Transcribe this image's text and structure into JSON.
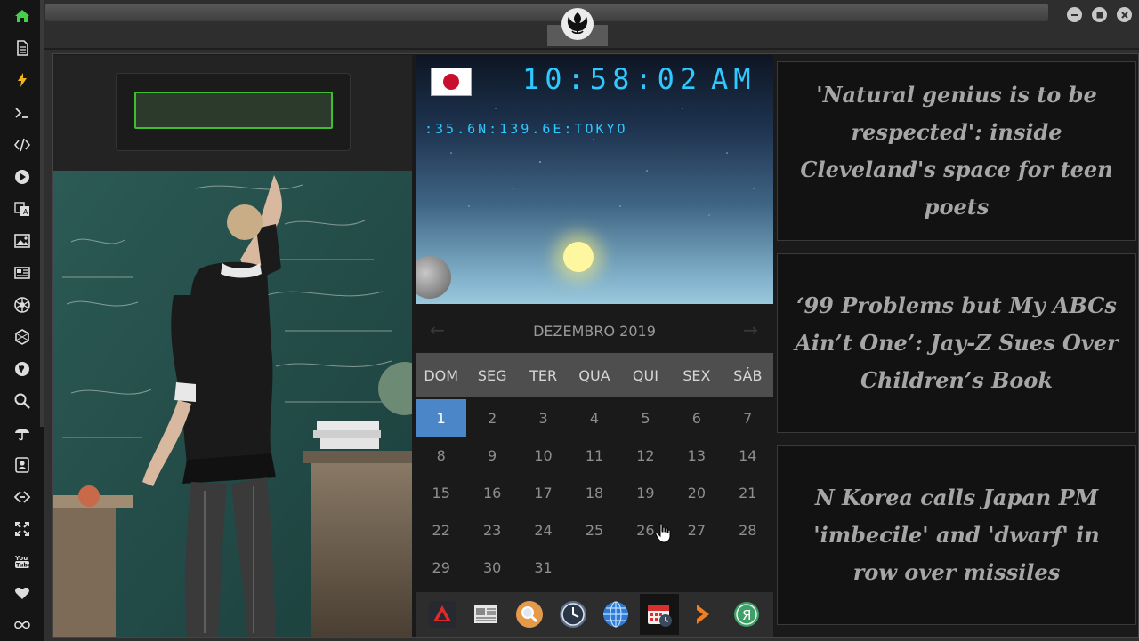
{
  "clock": {
    "time": "10:58:02",
    "ampm": "AM",
    "coords": ":35.6N:139.6E:TOKYO",
    "flag": "japan-flag-icon"
  },
  "calendar": {
    "month_label": "DEZEMBRO 2019",
    "prev_icon": "←",
    "next_icon": "→",
    "weekdays": [
      "DOM",
      "SEG",
      "TER",
      "QUA",
      "QUI",
      "SEX",
      "SÁB"
    ],
    "days": [
      "1",
      "2",
      "3",
      "4",
      "5",
      "6",
      "7",
      "8",
      "9",
      "10",
      "11",
      "12",
      "13",
      "14",
      "15",
      "16",
      "17",
      "18",
      "19",
      "20",
      "21",
      "22",
      "23",
      "24",
      "25",
      "26",
      "27",
      "28",
      "29",
      "30",
      "31"
    ],
    "today": "1",
    "accent": "#4a86c8"
  },
  "news": [
    "'Natural genius is to be respected': inside Cleveland's space for teen poets",
    "‘99 Problems but My ABCs Ain’t One’: Jay-Z Sues Over Children’s Book",
    "N Korea calls Japan PM 'imbecile' and 'dwarf' in row over missiles"
  ],
  "sidebar": {
    "items": [
      "home-icon",
      "document-icon",
      "bolt-icon",
      "terminal-icon",
      "code-icon",
      "play-icon",
      "translate-icon",
      "image-icon",
      "newspaper-icon",
      "aperture-icon",
      "hexagon-icon",
      "globe-icon",
      "search-icon",
      "umbrella-icon",
      "contacts-icon",
      "link-icon",
      "expand-icon",
      "youtube-icon",
      "heart-icon",
      "infinity-icon"
    ],
    "active_color": "#44d14a"
  },
  "dock": {
    "items": [
      "red-triangle-app-icon",
      "news-app-icon",
      "search-app-icon",
      "clock-app-icon",
      "globe-app-icon",
      "calendar-app-icon",
      "arrow-app-icon",
      "yandex-app-icon"
    ]
  },
  "search": {
    "border_color": "#3fbf2f"
  },
  "window": {
    "logo": "rebel-alliance-logo-icon"
  }
}
